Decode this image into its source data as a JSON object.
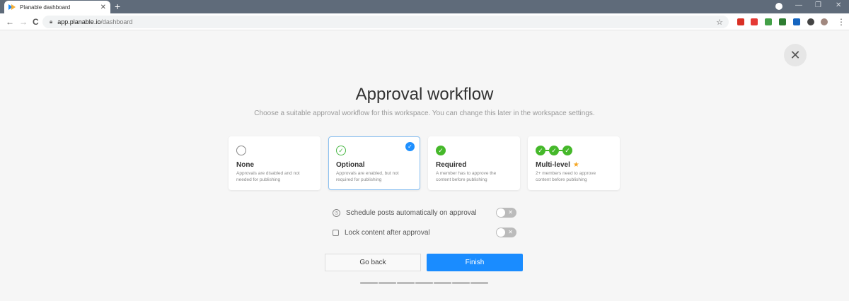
{
  "browser": {
    "tab_title": "Planable dashboard",
    "tab_close": "✕",
    "new_tab": "+",
    "url_host": "app.planable.io",
    "url_path": "/dashboard",
    "window_controls": {
      "minimize": "—",
      "restore": "❐",
      "close": "✕"
    },
    "nav": {
      "back": "←",
      "forward": "→",
      "reload": "C"
    }
  },
  "dialog": {
    "close_symbol": "✕",
    "title": "Approval workflow",
    "subtitle": "Choose a suitable approval workflow for this workspace. You can change this later in the workspace settings.",
    "workflows": [
      {
        "label": "None",
        "description": "Approvals are disabled and not needed for publishing",
        "icon": "empty-circle-icon",
        "selected": false
      },
      {
        "label": "Optional",
        "description": "Approvals are enabled, but not required for publishing",
        "icon": "outline-check-icon",
        "selected": true
      },
      {
        "label": "Required",
        "description": "A member has to approve the content before publishing",
        "icon": "green-check-icon",
        "selected": false
      },
      {
        "label": "Multi-level",
        "description": "2+ members need to approve content before publishing",
        "icon": "triple-check-icon",
        "selected": false
      }
    ],
    "options": [
      {
        "label": "Schedule posts automatically on approval",
        "icon": "clock-icon",
        "enabled": false
      },
      {
        "label": "Lock content after approval",
        "icon": "lock-icon",
        "enabled": false
      }
    ],
    "back_label": "Go back",
    "finish_label": "Finish",
    "progress_steps": 7
  },
  "colors": {
    "primary": "#1a8cff",
    "success": "#45b82a",
    "star": "#f5a623",
    "background": "#f6f6f6"
  }
}
